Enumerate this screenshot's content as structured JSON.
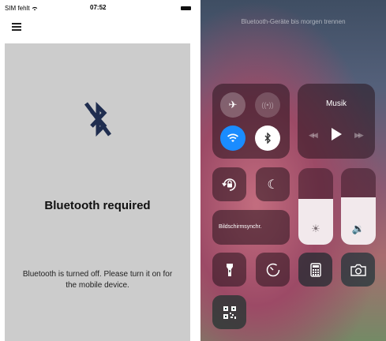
{
  "left_phone": {
    "status": {
      "carrier": "SIM fehlt",
      "time": "07:52"
    },
    "title": "Bluetooth required",
    "message": "Bluetooth is turned off. Please turn it on for the mobile device."
  },
  "control_center": {
    "notice": "Bluetooth-Geräte bis morgen trennen",
    "connectivity": {
      "airplane_icon": "airplane-icon",
      "cellular_icon": "cellular-icon",
      "wifi_icon": "wifi-icon",
      "bluetooth_icon": "bluetooth-icon",
      "wifi_active_color": "#1a8cff",
      "bluetooth_active_color": "#ffffff"
    },
    "music": {
      "title": "Musik"
    },
    "screen_mirroring_label": "Bildschirmsynchr.",
    "brightness_level": 0.6,
    "volume_level": 0.62
  }
}
